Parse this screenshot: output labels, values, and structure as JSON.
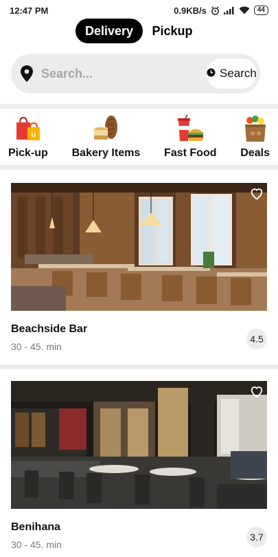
{
  "status_bar": {
    "time": "12:47 PM",
    "network_speed": "0.9KB/s",
    "battery": "44",
    "icons": [
      "alarm-icon",
      "signal-icon",
      "wifi-icon",
      "battery-icon"
    ]
  },
  "mode_toggle": {
    "delivery_label": "Delivery",
    "pickup_label": "Pickup",
    "selected": "Delivery"
  },
  "search": {
    "placeholder": "Search...",
    "button_label": "Search"
  },
  "categories": [
    {
      "label": "Pick-up",
      "icon": "shopping-bags-icon"
    },
    {
      "label": "Bakery Items",
      "icon": "bread-icon"
    },
    {
      "label": "Fast Food",
      "icon": "burger-drink-icon"
    },
    {
      "label": "Deals",
      "icon": "grocery-bag-icon"
    }
  ],
  "restaurants": [
    {
      "name": "Beachside Bar",
      "time": "30 - 45. min",
      "rating": "4.5"
    },
    {
      "name": "Benihana",
      "time": "30 - 45. min",
      "rating": "3.7"
    }
  ],
  "colors": {
    "accent": "#000000",
    "surface": "#ececec",
    "muted_text": "#777777"
  }
}
